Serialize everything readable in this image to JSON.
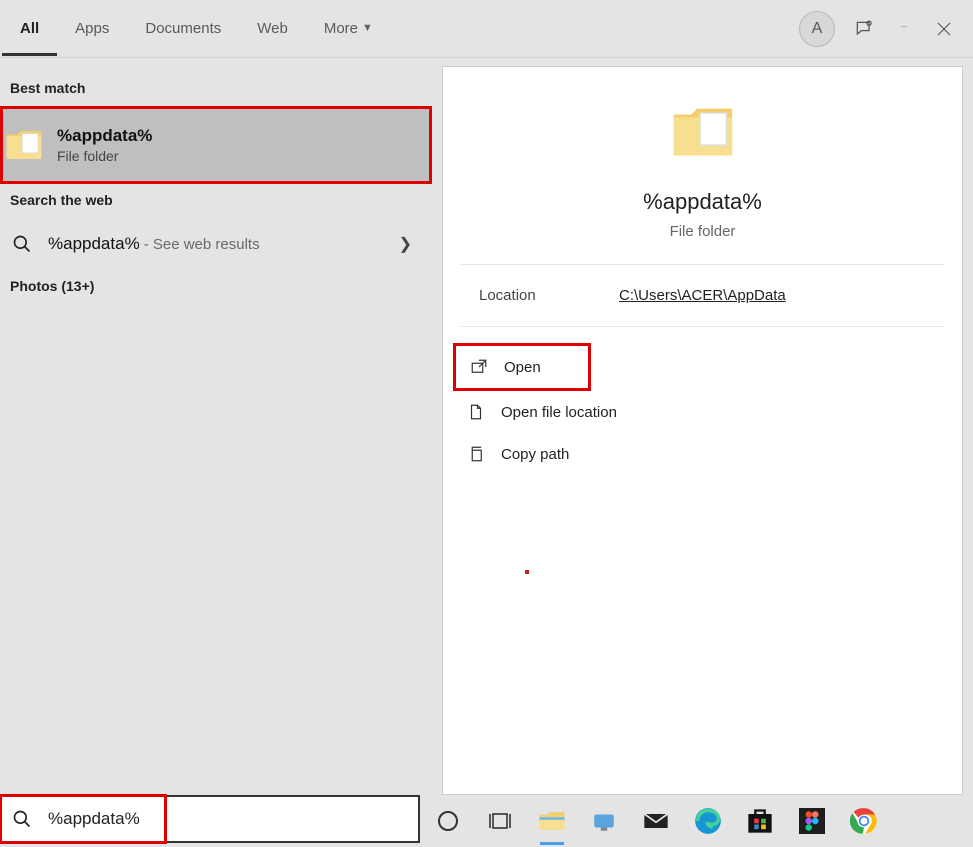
{
  "tabs": {
    "all": "All",
    "apps": "Apps",
    "documents": "Documents",
    "web": "Web",
    "more": "More"
  },
  "avatar_letter": "A",
  "sections": {
    "best_match": "Best match",
    "search_web": "Search the web",
    "photos": "Photos (13+)"
  },
  "best_match": {
    "title": "%appdata%",
    "subtitle": "File folder"
  },
  "web_result": {
    "query": "%appdata%",
    "hint": "- See web results"
  },
  "detail": {
    "title": "%appdata%",
    "subtitle": "File folder",
    "location_label": "Location",
    "location_value": "C:\\Users\\ACER\\AppData",
    "actions": {
      "open": "Open",
      "open_file_location": "Open file location",
      "copy_path": "Copy path"
    }
  },
  "search_input": {
    "value": "%appdata%"
  }
}
